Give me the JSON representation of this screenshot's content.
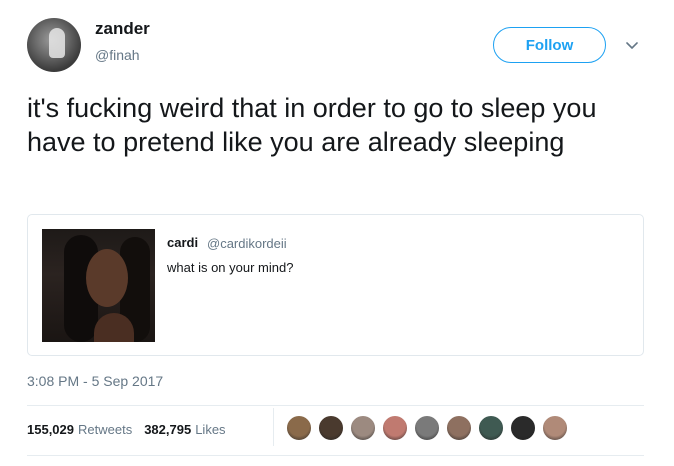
{
  "author": {
    "display_name": "zander",
    "handle": "@finah"
  },
  "follow_button": {
    "label": "Follow",
    "accent": "#1da1f2"
  },
  "tweet": {
    "text": "it's fucking weird that in order to go to sleep you have to pretend like you are already sleeping",
    "timestamp": "3:08 PM - 5 Sep 2017"
  },
  "quoted": {
    "display_name": "cardi",
    "handle": "@cardikordeii",
    "text": "what is on your mind?"
  },
  "stats": {
    "retweets_count": "155,029",
    "retweets_label": "Retweets",
    "likes_count": "382,795",
    "likes_label": "Likes"
  },
  "likers": [
    {
      "name": "liker-avatar-1",
      "color": "#8a6a4a"
    },
    {
      "name": "liker-avatar-2",
      "color": "#4a3a2e"
    },
    {
      "name": "liker-avatar-3",
      "color": "#9c8a80"
    },
    {
      "name": "liker-avatar-4",
      "color": "#c07a70"
    },
    {
      "name": "liker-avatar-5",
      "color": "#7a7a7a"
    },
    {
      "name": "liker-avatar-6",
      "color": "#8e7060"
    },
    {
      "name": "liker-avatar-7",
      "color": "#3f5a52"
    },
    {
      "name": "liker-avatar-8",
      "color": "#2a2a2a"
    },
    {
      "name": "liker-avatar-9",
      "color": "#b08a78"
    }
  ],
  "icons": {
    "more": "chevron-down-icon"
  }
}
